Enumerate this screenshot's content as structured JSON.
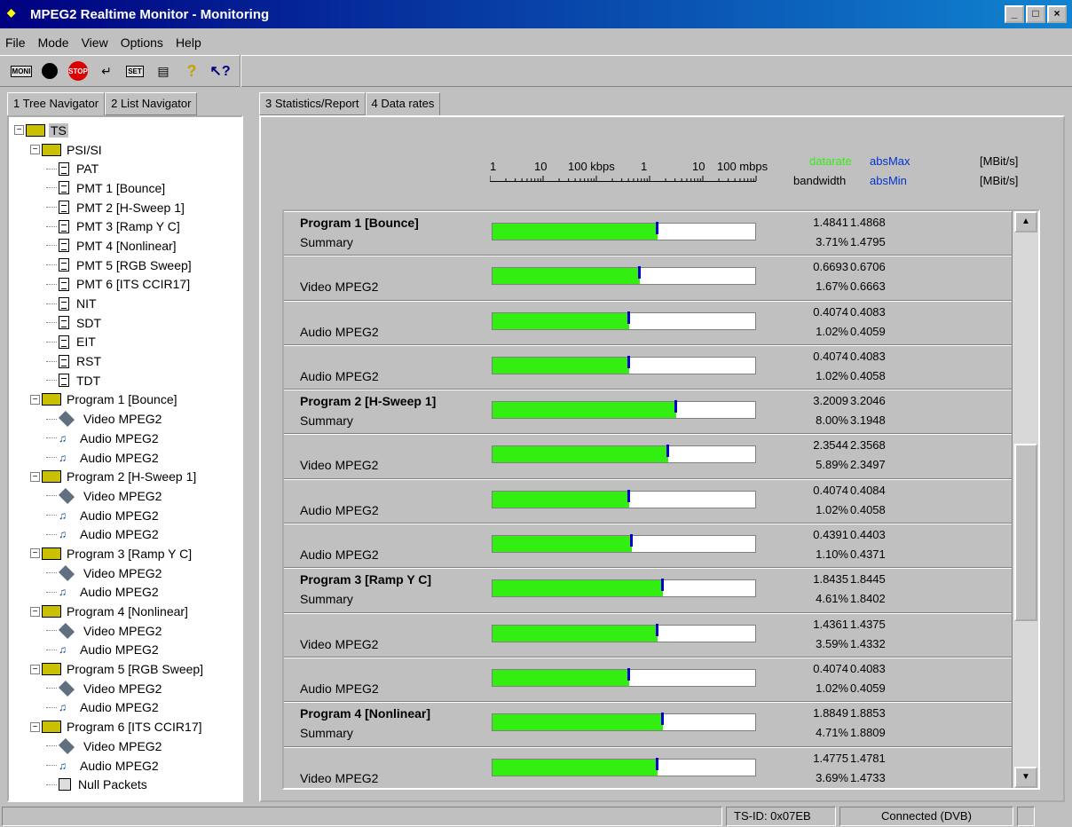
{
  "window": {
    "title": "MPEG2 Realtime Monitor - Monitoring",
    "buttons": [
      "_",
      "□",
      "×"
    ]
  },
  "menu": [
    "File",
    "Mode",
    "View",
    "Options",
    "Help"
  ],
  "toolbar": {
    "moni": "MONI",
    "set": "SET",
    "stop": "STOP",
    "help": "?",
    "context_help": "?"
  },
  "left_tabs": [
    "1 Tree Navigator",
    "2 List Navigator"
  ],
  "tree": [
    {
      "level": 0,
      "label": "TS",
      "icon": "folder",
      "toggle": "minus",
      "selected": true
    },
    {
      "level": 1,
      "label": "PSI/SI",
      "icon": "folder",
      "toggle": "minus"
    },
    {
      "level": 2,
      "label": "PAT",
      "icon": "doc"
    },
    {
      "level": 2,
      "label": "PMT 1 [Bounce]",
      "icon": "doc"
    },
    {
      "level": 2,
      "label": "PMT 2 [H-Sweep 1]",
      "icon": "doc"
    },
    {
      "level": 2,
      "label": "PMT 3 [Ramp Y C]",
      "icon": "doc"
    },
    {
      "level": 2,
      "label": "PMT 4 [Nonlinear]",
      "icon": "doc"
    },
    {
      "level": 2,
      "label": "PMT 5 [RGB Sweep]",
      "icon": "doc"
    },
    {
      "level": 2,
      "label": "PMT 6 [ITS CCIR17]",
      "icon": "doc"
    },
    {
      "level": 2,
      "label": "NIT",
      "icon": "doc"
    },
    {
      "level": 2,
      "label": "SDT",
      "icon": "doc"
    },
    {
      "level": 2,
      "label": "EIT",
      "icon": "doc"
    },
    {
      "level": 2,
      "label": "RST",
      "icon": "doc"
    },
    {
      "level": 2,
      "label": "TDT",
      "icon": "doc"
    },
    {
      "level": 1,
      "label": "Program 1 [Bounce]",
      "icon": "folder",
      "toggle": "minus"
    },
    {
      "level": 2,
      "label": "Video MPEG2",
      "icon": "video"
    },
    {
      "level": 2,
      "label": "Audio MPEG2",
      "icon": "audio"
    },
    {
      "level": 2,
      "label": "Audio MPEG2",
      "icon": "audio"
    },
    {
      "level": 1,
      "label": "Program 2 [H-Sweep 1]",
      "icon": "folder",
      "toggle": "minus"
    },
    {
      "level": 2,
      "label": "Video MPEG2",
      "icon": "video"
    },
    {
      "level": 2,
      "label": "Audio MPEG2",
      "icon": "audio"
    },
    {
      "level": 2,
      "label": "Audio MPEG2",
      "icon": "audio"
    },
    {
      "level": 1,
      "label": "Program 3 [Ramp Y C]",
      "icon": "folder",
      "toggle": "minus"
    },
    {
      "level": 2,
      "label": "Video MPEG2",
      "icon": "video"
    },
    {
      "level": 2,
      "label": "Audio MPEG2",
      "icon": "audio"
    },
    {
      "level": 1,
      "label": "Program 4 [Nonlinear]",
      "icon": "folder",
      "toggle": "minus"
    },
    {
      "level": 2,
      "label": "Video MPEG2",
      "icon": "video"
    },
    {
      "level": 2,
      "label": "Audio MPEG2",
      "icon": "audio"
    },
    {
      "level": 1,
      "label": "Program 5 [RGB Sweep]",
      "icon": "folder",
      "toggle": "minus"
    },
    {
      "level": 2,
      "label": "Video MPEG2",
      "icon": "video"
    },
    {
      "level": 2,
      "label": "Audio MPEG2",
      "icon": "audio"
    },
    {
      "level": 1,
      "label": "Program 6 [ITS CCIR17]",
      "icon": "folder",
      "toggle": "minus"
    },
    {
      "level": 2,
      "label": "Video MPEG2",
      "icon": "video"
    },
    {
      "level": 2,
      "label": "Audio MPEG2",
      "icon": "audio"
    },
    {
      "level": 2,
      "label": "Null Packets",
      "icon": "null"
    }
  ],
  "right_tabs": [
    "3 Statistics/Report",
    "4 Data rates"
  ],
  "scale": {
    "labels": [
      "1",
      "10",
      "100 kbps",
      "1",
      "10",
      "100 mbps"
    ]
  },
  "header": {
    "datarate": "datarate",
    "absMax": "absMax",
    "unit1": "[MBit/s]",
    "bandwidth": "bandwidth",
    "absMin": "absMin",
    "unit2": "[MBit/s]",
    "datarate_color": "#33ee11",
    "abs_color": "#0033cc"
  },
  "rows": [
    {
      "name": "Program 1 [Bounce]",
      "sub": "Summary",
      "bold": true,
      "level": 0.63,
      "rate": "1.4841",
      "pct": "3.71%",
      "max": "1.4868",
      "min": "1.4795"
    },
    {
      "name": "",
      "sub": "Video MPEG2",
      "bold": false,
      "level": 0.56,
      "rate": "0.6693",
      "pct": "1.67%",
      "max": "0.6706",
      "min": "0.6663"
    },
    {
      "name": "",
      "sub": "Audio MPEG2",
      "bold": false,
      "level": 0.52,
      "rate": "0.4074",
      "pct": "1.02%",
      "max": "0.4083",
      "min": "0.4059"
    },
    {
      "name": "",
      "sub": "Audio MPEG2",
      "bold": false,
      "level": 0.52,
      "rate": "0.4074",
      "pct": "1.02%",
      "max": "0.4083",
      "min": "0.4058"
    },
    {
      "name": "Program 2 [H-Sweep 1]",
      "sub": "Summary",
      "bold": true,
      "level": 0.7,
      "rate": "3.2009",
      "pct": "8.00%",
      "max": "3.2046",
      "min": "3.1948"
    },
    {
      "name": "",
      "sub": "Video MPEG2",
      "bold": false,
      "level": 0.67,
      "rate": "2.3544",
      "pct": "5.89%",
      "max": "2.3568",
      "min": "2.3497"
    },
    {
      "name": "",
      "sub": "Audio MPEG2",
      "bold": false,
      "level": 0.52,
      "rate": "0.4074",
      "pct": "1.02%",
      "max": "0.4084",
      "min": "0.4058"
    },
    {
      "name": "",
      "sub": "Audio MPEG2",
      "bold": false,
      "level": 0.53,
      "rate": "0.4391",
      "pct": "1.10%",
      "max": "0.4403",
      "min": "0.4371"
    },
    {
      "name": "Program 3 [Ramp Y C]",
      "sub": "Summary",
      "bold": true,
      "level": 0.65,
      "rate": "1.8435",
      "pct": "4.61%",
      "max": "1.8445",
      "min": "1.8402"
    },
    {
      "name": "",
      "sub": "Video MPEG2",
      "bold": false,
      "level": 0.63,
      "rate": "1.4361",
      "pct": "3.59%",
      "max": "1.4375",
      "min": "1.4332"
    },
    {
      "name": "",
      "sub": "Audio MPEG2",
      "bold": false,
      "level": 0.52,
      "rate": "0.4074",
      "pct": "1.02%",
      "max": "0.4083",
      "min": "0.4059"
    },
    {
      "name": "Program 4 [Nonlinear]",
      "sub": "Summary",
      "bold": true,
      "level": 0.65,
      "rate": "1.8849",
      "pct": "4.71%",
      "max": "1.8853",
      "min": "1.8809"
    },
    {
      "name": "",
      "sub": "Video MPEG2",
      "bold": false,
      "level": 0.63,
      "rate": "1.4775",
      "pct": "3.69%",
      "max": "1.4781",
      "min": "1.4733"
    }
  ],
  "status": {
    "ts_id": "TS-ID: 0x07EB",
    "connection": "Connected (DVB)"
  }
}
